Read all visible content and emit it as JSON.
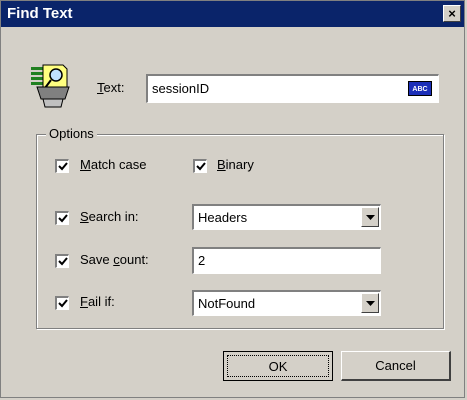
{
  "window": {
    "title": "Find Text",
    "close_glyph": "×"
  },
  "search": {
    "text_label_ul": "T",
    "text_label_rest": "ext:",
    "text_value": "sessionID",
    "abc_icon_text": "ABC",
    "icon": "find-text-icon"
  },
  "options": {
    "group_title": "Options",
    "match_case": {
      "ul": "M",
      "rest": "atch case",
      "checked": true
    },
    "binary": {
      "ul": "B",
      "rest": "inary",
      "checked": true
    },
    "search_in": {
      "ul": "S",
      "rest": "earch in:",
      "checked": true,
      "value": "Headers"
    },
    "save_count": {
      "pre": "Save ",
      "ul": "c",
      "rest": "ount:",
      "checked": true,
      "value": "2"
    },
    "fail_if": {
      "ul": "F",
      "rest": "ail if:",
      "checked": true,
      "value": "NotFound"
    }
  },
  "buttons": {
    "ok": "OK",
    "cancel": "Cancel"
  }
}
